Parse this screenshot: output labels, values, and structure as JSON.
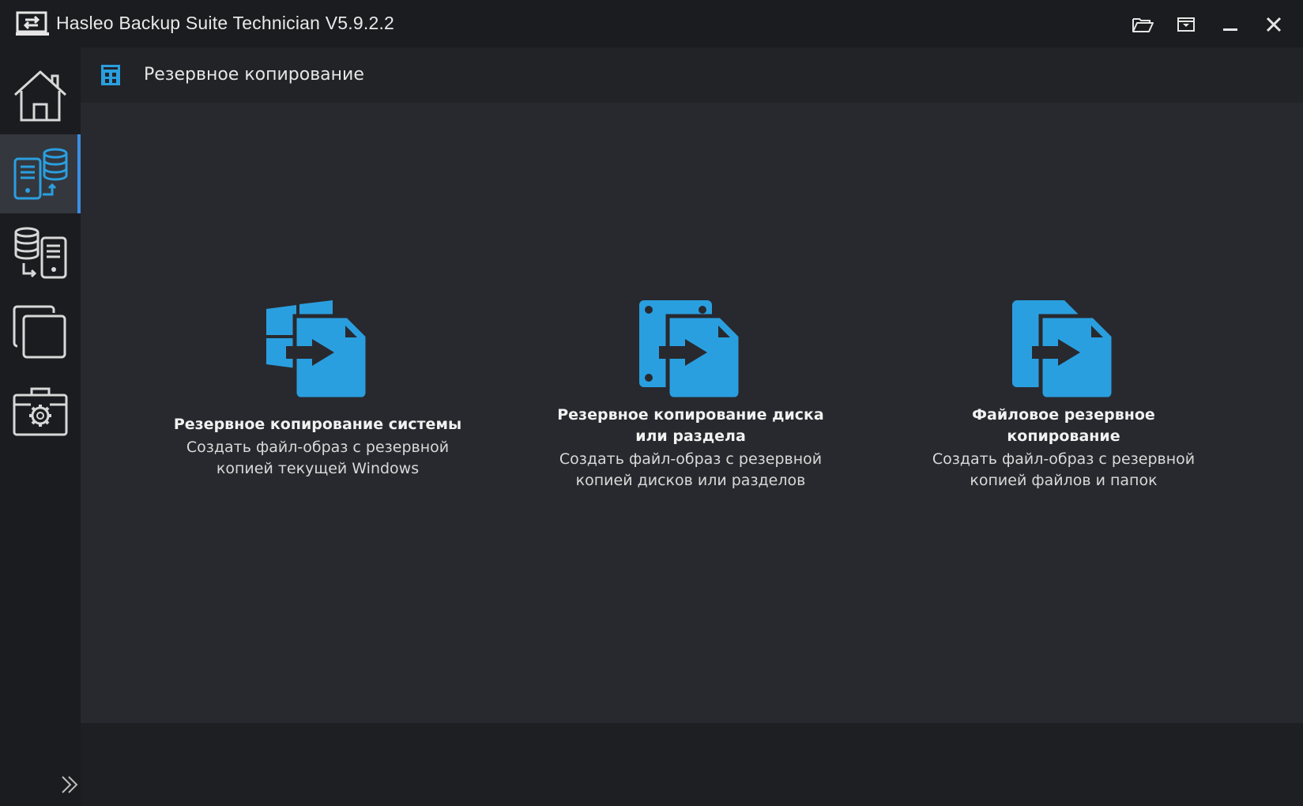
{
  "window": {
    "title": "Hasleo Backup Suite Technician V5.9.2.2"
  },
  "titlebar_buttons": [
    {
      "icon": "open-folder-icon"
    },
    {
      "icon": "menu-dropdown-icon"
    },
    {
      "icon": "minimize-icon"
    },
    {
      "icon": "close-icon"
    }
  ],
  "sidebar": {
    "items": [
      {
        "icon": "home-icon",
        "active": false
      },
      {
        "icon": "backup-icon",
        "active": true
      },
      {
        "icon": "restore-icon",
        "active": false
      },
      {
        "icon": "clone-icon",
        "active": false
      },
      {
        "icon": "tools-icon",
        "active": false
      }
    ]
  },
  "header": {
    "title": "Резервное копирование"
  },
  "cards": [
    {
      "title_line1": "Резервное копирование системы",
      "title_line2": "",
      "desc_line1": "Создать файл-образ с резервной",
      "desc_line2": "копией текущей Windows"
    },
    {
      "title_line1": "Резервное копирование диска",
      "title_line2": "или раздела",
      "desc_line1": "Создать файл-образ с резервной",
      "desc_line2": "копией дисков или разделов"
    },
    {
      "title_line1": "Файловое резервное",
      "title_line2": "копирование",
      "desc_line1": "Создать файл-образ с резервной",
      "desc_line2": "копией файлов и папок"
    }
  ],
  "colors": {
    "accent": "#2a9fe0",
    "active_bar": "#3a8ee6",
    "background": "#1b1c1f",
    "content_bg": "#28292e"
  }
}
